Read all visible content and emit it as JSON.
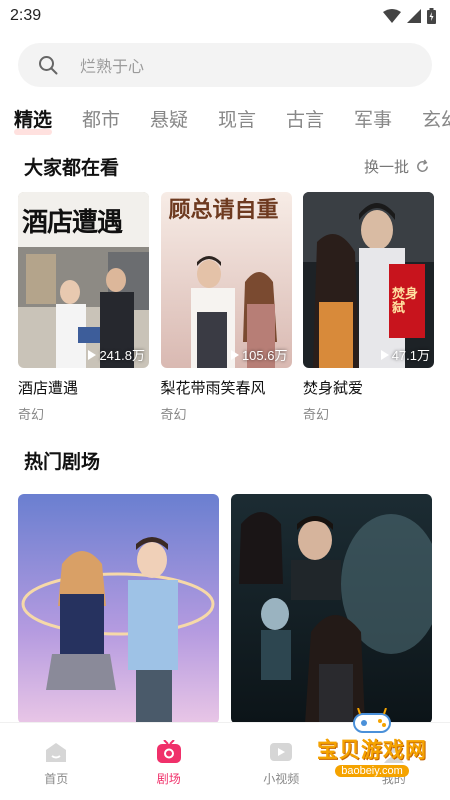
{
  "status": {
    "time": "2:39"
  },
  "search": {
    "placeholder": "烂熟于心"
  },
  "tabs": [
    "精选",
    "都市",
    "悬疑",
    "现言",
    "古言",
    "军事",
    "玄幻"
  ],
  "section1": {
    "title": "大家都在看",
    "refresh": "换一批"
  },
  "cards": [
    {
      "title": "酒店遭遇",
      "tag": "奇幻",
      "views": "241.8万",
      "poster_text": "酒店遭遇"
    },
    {
      "title": "梨花带雨笑春风",
      "tag": "奇幻",
      "views": "105.6万",
      "poster_text": "顾总请自重"
    },
    {
      "title": "焚身弑爱",
      "tag": "奇幻",
      "views": "47.1万",
      "poster_text": "焚身弑"
    }
  ],
  "section2": {
    "title": "热门剧场"
  },
  "nav": [
    {
      "label": "首页",
      "icon": "home-icon",
      "active": false
    },
    {
      "label": "剧场",
      "icon": "theater-icon",
      "active": true
    },
    {
      "label": "小视频",
      "icon": "video-icon",
      "active": false
    },
    {
      "label": "我的",
      "icon": "profile-icon",
      "active": false
    }
  ],
  "watermark": {
    "text": "宝贝游戏网",
    "url": "baobeiy.com"
  },
  "colors": {
    "accent": "#f0306a",
    "watermark": "#f5a300"
  }
}
